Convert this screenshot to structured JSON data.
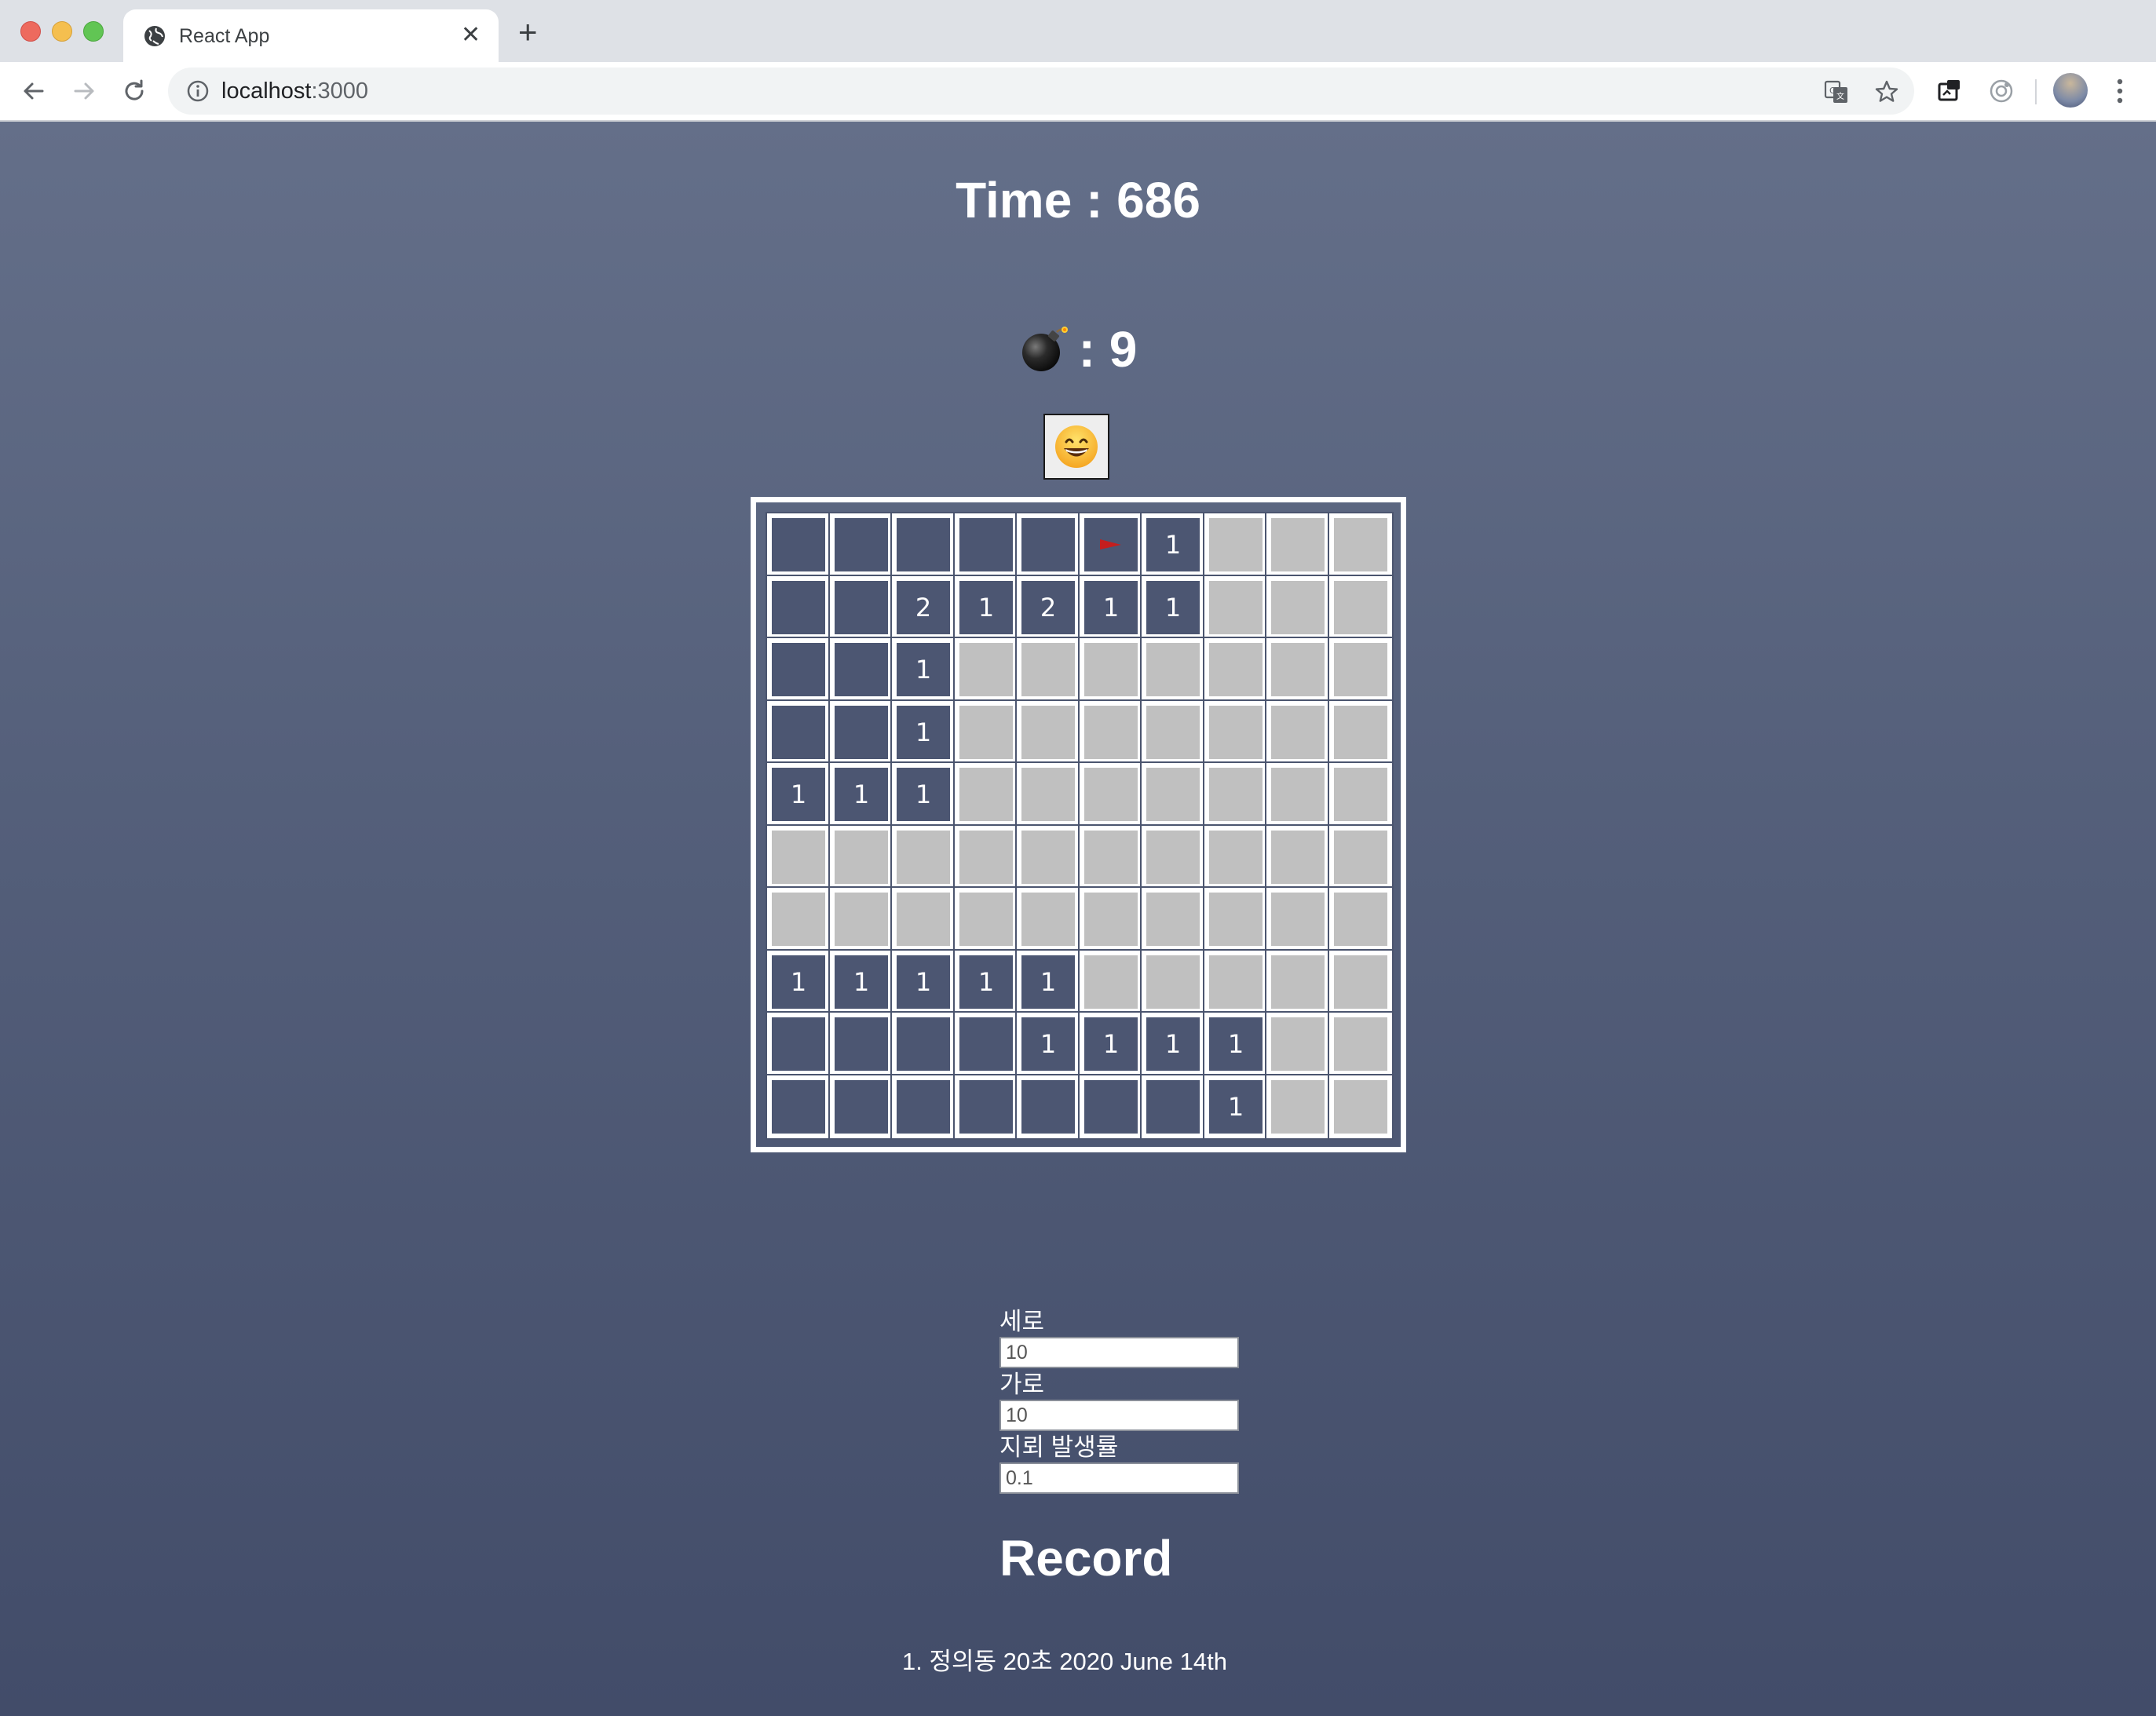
{
  "browser": {
    "tab_title": "React App",
    "url_host": "localhost",
    "url_port": ":3000"
  },
  "game": {
    "time_label": "Time : 686",
    "mine_count_label": ": 9",
    "face_state": "grinning-face",
    "board": {
      "rows": 10,
      "cols": 10,
      "cells": [
        [
          "",
          "",
          "",
          "",
          "",
          "F",
          "1",
          "#",
          "#",
          "#"
        ],
        [
          "",
          "",
          "2",
          "1",
          "2",
          "1",
          "1",
          "#",
          "#",
          "#"
        ],
        [
          "",
          "",
          "1",
          "#",
          "#",
          "#",
          "#",
          "#",
          "#",
          "#"
        ],
        [
          "",
          "",
          "1",
          "#",
          "#",
          "#",
          "#",
          "#",
          "#",
          "#"
        ],
        [
          "1",
          "1",
          "1",
          "#",
          "#",
          "#",
          "#",
          "#",
          "#",
          "#"
        ],
        [
          "#",
          "#",
          "#",
          "#",
          "#",
          "#",
          "#",
          "#",
          "#",
          "#"
        ],
        [
          "#",
          "#",
          "#",
          "#",
          "#",
          "#",
          "#",
          "#",
          "#",
          "#"
        ],
        [
          "1",
          "1",
          "1",
          "1",
          "1",
          "#",
          "#",
          "#",
          "#",
          "#"
        ],
        [
          "",
          "",
          "",
          "",
          "1",
          "1",
          "1",
          "1",
          "#",
          "#"
        ],
        [
          "",
          "",
          "",
          "",
          "",
          "",
          "",
          "1",
          "#",
          "#"
        ]
      ],
      "legend": {
        "open_empty": "",
        "closed": "#",
        "flag": "F"
      }
    }
  },
  "settings": {
    "rows_label": "세로",
    "rows_value": "10",
    "cols_label": "가로",
    "cols_value": "10",
    "mine_rate_label": "지뢰 발생률",
    "mine_rate_value": "0.1"
  },
  "record": {
    "title": "Record",
    "entries": [
      "1. 정의동 20초 2020 June 14th"
    ]
  },
  "colors": {
    "cell_open": "#4c5672",
    "cell_closed": "#c0c0c0",
    "flag": "#c41e1e"
  }
}
